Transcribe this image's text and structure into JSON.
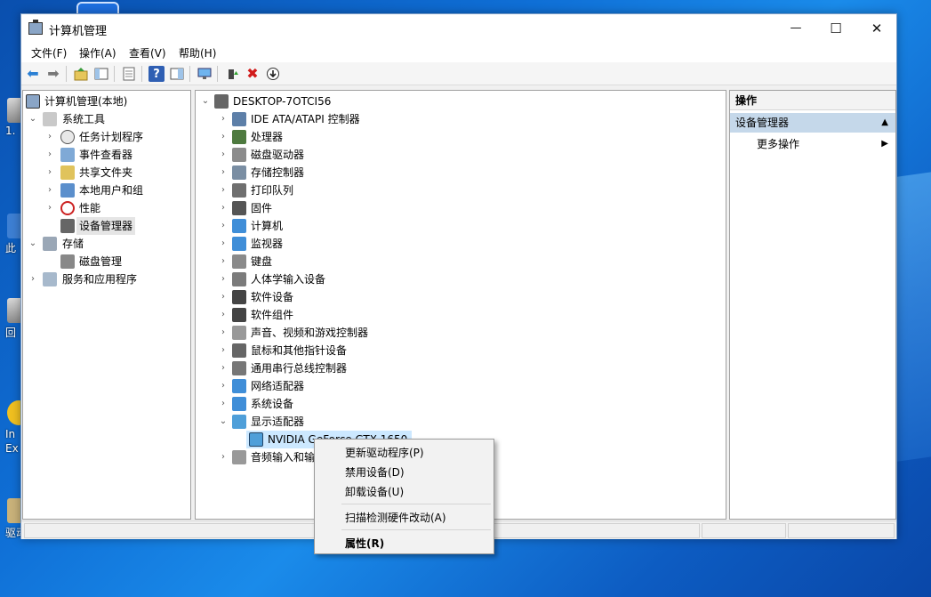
{
  "desktop": {
    "icons": [
      {
        "name": "desktop-icon-1",
        "label": "1."
      },
      {
        "name": "desktop-icon-2",
        "label": "此"
      },
      {
        "name": "desktop-icon-3",
        "label": "回"
      },
      {
        "name": "desktop-icon-ie",
        "label": "In Ex"
      },
      {
        "name": "desktop-icon-driver",
        "label": "驱动"
      }
    ]
  },
  "window": {
    "title": "计算机管理",
    "controls": {
      "minimize": "—",
      "maximize": "☐",
      "close": "✕"
    }
  },
  "menu": [
    "文件(F)",
    "操作(A)",
    "查看(V)",
    "帮助(H)"
  ],
  "toolbar": {
    "icons": [
      "back-arrow-icon",
      "forward-arrow-icon",
      "folder-up-icon",
      "show-hide-tree-icon",
      "properties-icon",
      "help-icon",
      "show-action-pane-icon",
      "monitor-icon",
      "update-driver-icon",
      "uninstall-icon",
      "download-icon"
    ]
  },
  "tree": {
    "root": "计算机管理(本地)",
    "items": [
      {
        "label": "系统工具",
        "level": 1,
        "expanded": true
      },
      {
        "label": "任务计划程序",
        "level": 2
      },
      {
        "label": "事件查看器",
        "level": 2
      },
      {
        "label": "共享文件夹",
        "level": 2
      },
      {
        "label": "本地用户和组",
        "level": 2
      },
      {
        "label": "性能",
        "level": 2
      },
      {
        "label": "设备管理器",
        "level": 2,
        "selected": true
      },
      {
        "label": "存储",
        "level": 1,
        "expanded": true
      },
      {
        "label": "磁盘管理",
        "level": 2
      },
      {
        "label": "服务和应用程序",
        "level": 1
      }
    ]
  },
  "devices": {
    "computer": "DESKTOP-7OTCI56",
    "categories": [
      "IDE ATA/ATAPI 控制器",
      "处理器",
      "磁盘驱动器",
      "存储控制器",
      "打印队列",
      "固件",
      "计算机",
      "监视器",
      "键盘",
      "人体学输入设备",
      "软件设备",
      "软件组件",
      "声音、视频和游戏控制器",
      "鼠标和其他指针设备",
      "通用串行总线控制器",
      "网络适配器",
      "系统设备",
      "显示适配器"
    ],
    "display_child": "NVIDIA GeForce GTX 1650",
    "last_category": "音频输入和输出"
  },
  "actions": {
    "header": "操作",
    "section": "设备管理器",
    "more": "更多操作"
  },
  "context_menu": {
    "items": [
      "更新驱动程序(P)",
      "禁用设备(D)",
      "卸载设备(U)",
      "扫描检测硬件改动(A)",
      "属性(R)"
    ]
  },
  "colors": {
    "selection": "#cce8ff",
    "action_section": "#c5d8ea",
    "uninstall_red": "#d11a1a"
  }
}
